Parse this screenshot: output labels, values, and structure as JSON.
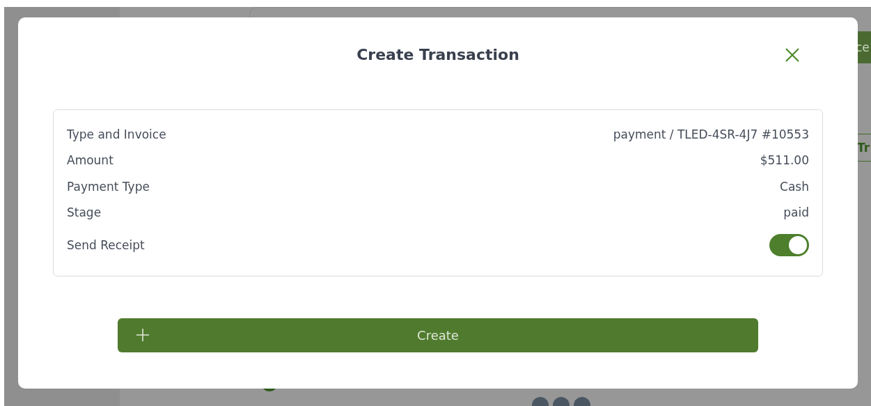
{
  "background": {
    "button_text": "ce",
    "tab_text": "Tr"
  },
  "dialog": {
    "title": "Create Transaction",
    "details": [
      {
        "label": "Type and Invoice",
        "value": "payment / TLED-4SR-4J7 #10553",
        "kind": "text"
      },
      {
        "label": "Amount",
        "value": "$511.00",
        "kind": "text"
      },
      {
        "label": "Payment Type",
        "value": "Cash",
        "kind": "text"
      },
      {
        "label": "Stage",
        "value": "paid",
        "kind": "text"
      },
      {
        "label": "Send Receipt",
        "kind": "toggle",
        "on": true
      }
    ],
    "submit_button": "Create"
  }
}
